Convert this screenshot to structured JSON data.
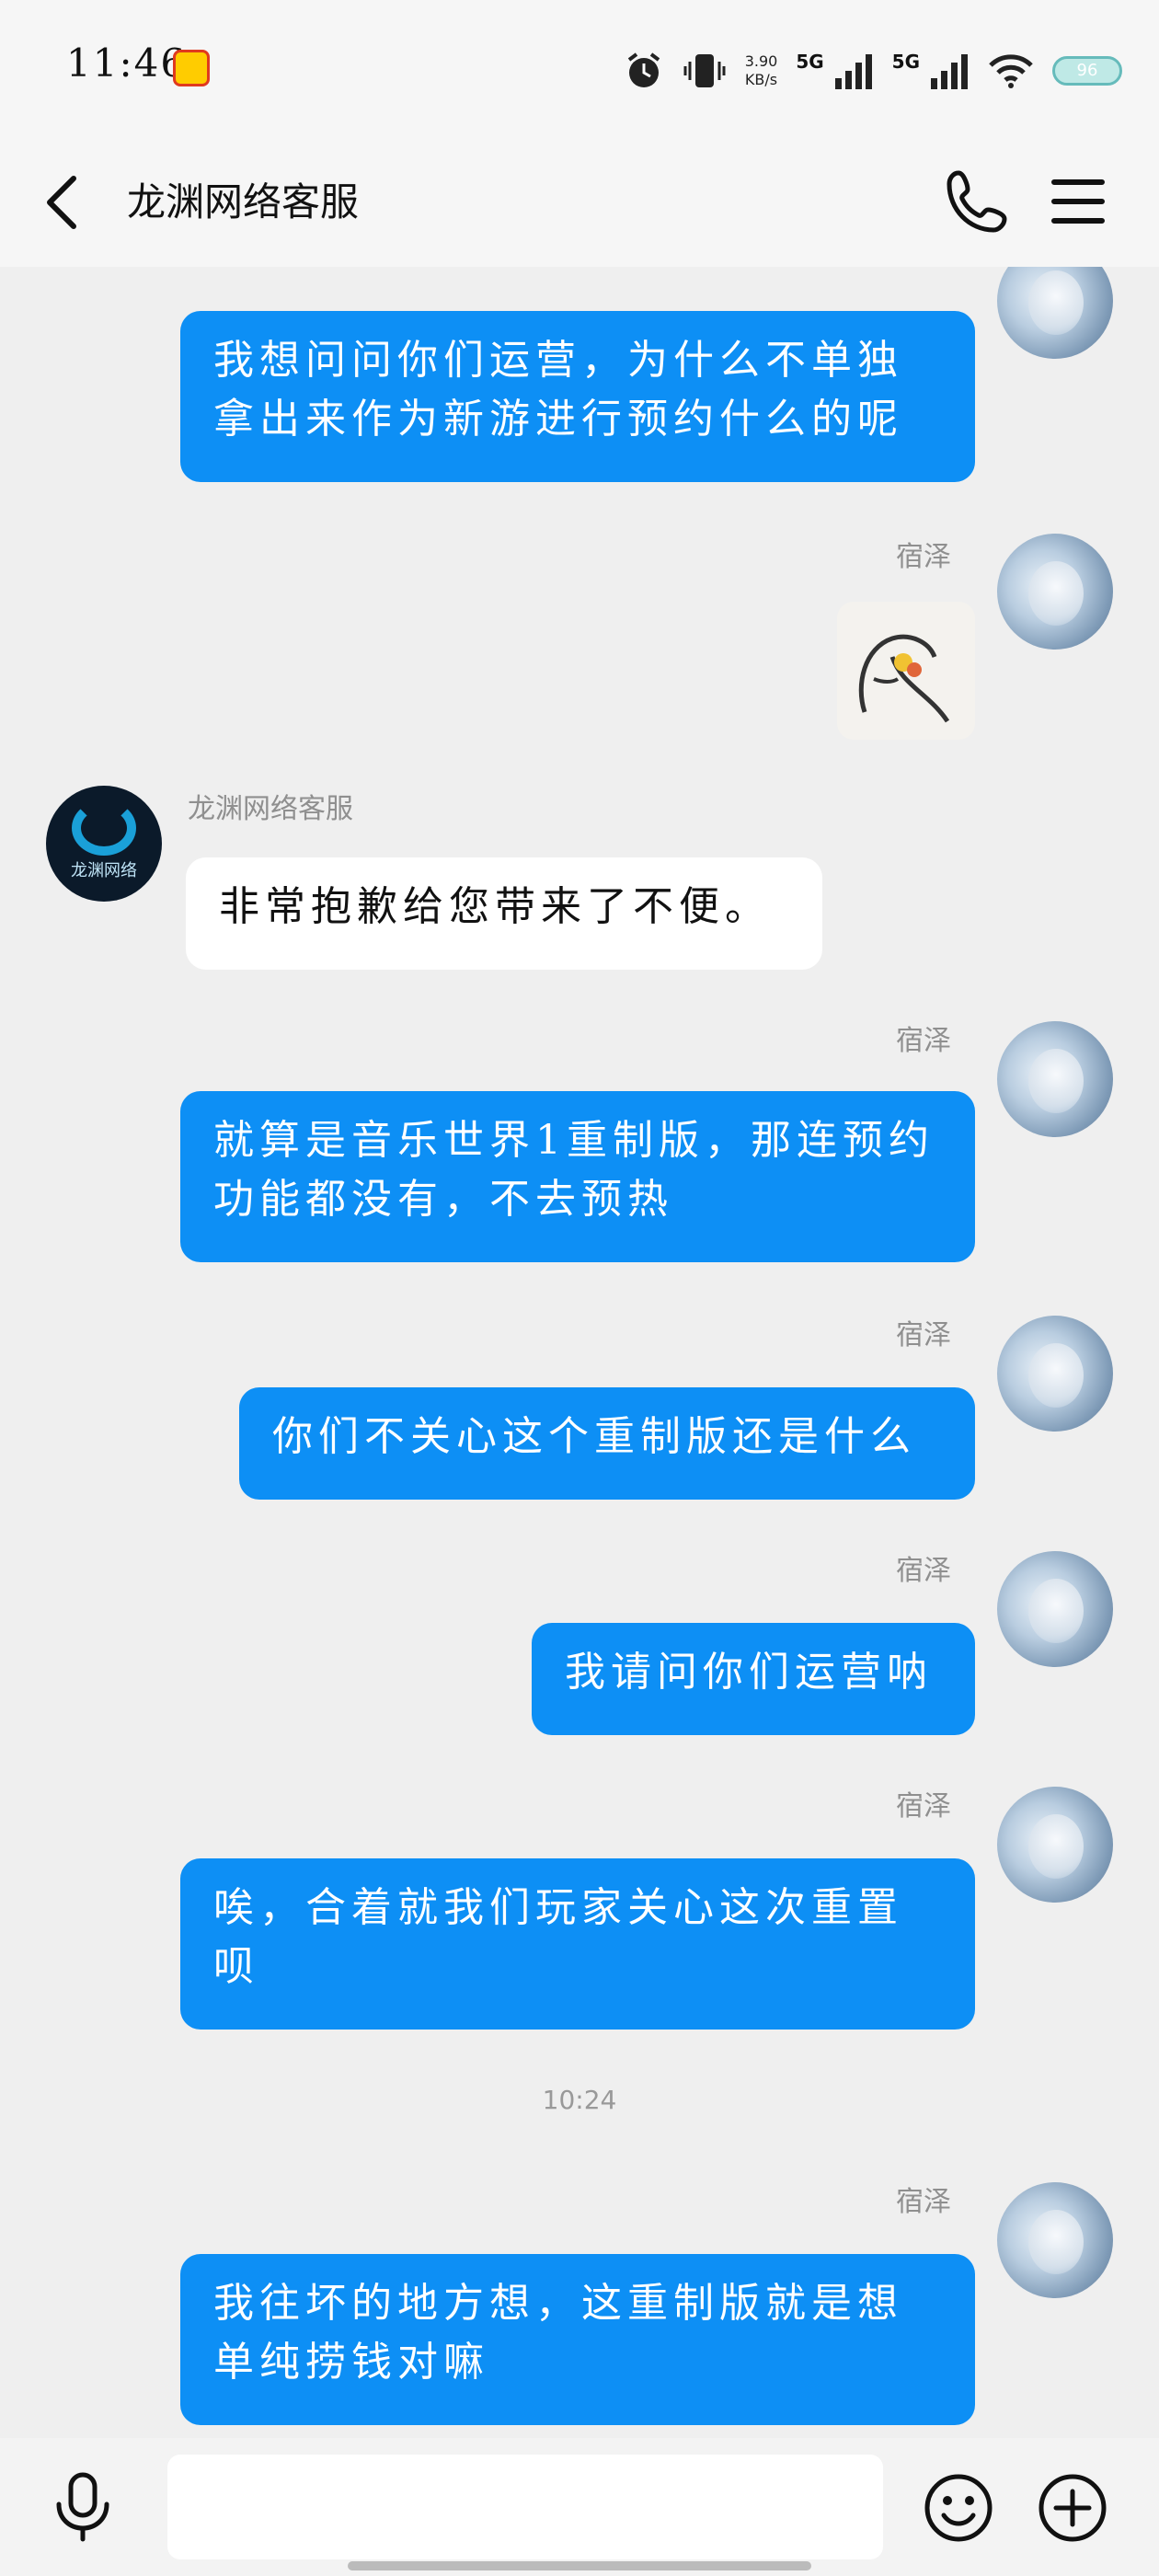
{
  "status_bar": {
    "time": "11:46",
    "network_speed": "3.90",
    "network_unit": "KB/s",
    "sim1": "5G",
    "sim2": "5G",
    "battery": "96"
  },
  "header": {
    "title": "龙渊网络客服"
  },
  "service_avatar_label": "龙渊网络",
  "messages": [
    {
      "sender": "宿泽",
      "text": "我想问问你们运营，为什么不单独拿出来作为新游进行预约什么的呢"
    },
    {
      "sender": "宿泽",
      "type": "sticker"
    },
    {
      "sender": "龙渊网络客服",
      "text": "非常抱歉给您带来了不便。"
    },
    {
      "sender": "宿泽",
      "text": "就算是音乐世界1重制版，那连预约功能都没有，不去预热"
    },
    {
      "sender": "宿泽",
      "text": "你们不关心这个重制版还是什么"
    },
    {
      "sender": "宿泽",
      "text": "我请问你们运营呐"
    },
    {
      "sender": "宿泽",
      "text": "唉，合着就我们玩家关心这次重置呗"
    },
    {
      "sender": "宿泽",
      "text": "我往坏的地方想，这重制版就是想单纯捞钱对嘛"
    }
  ],
  "timestamp": "10:24",
  "input": {
    "placeholder": ""
  },
  "colors": {
    "outgoing_bubble": "#0d8ff5",
    "incoming_bubble": "#ffffff",
    "background": "#efefef"
  }
}
